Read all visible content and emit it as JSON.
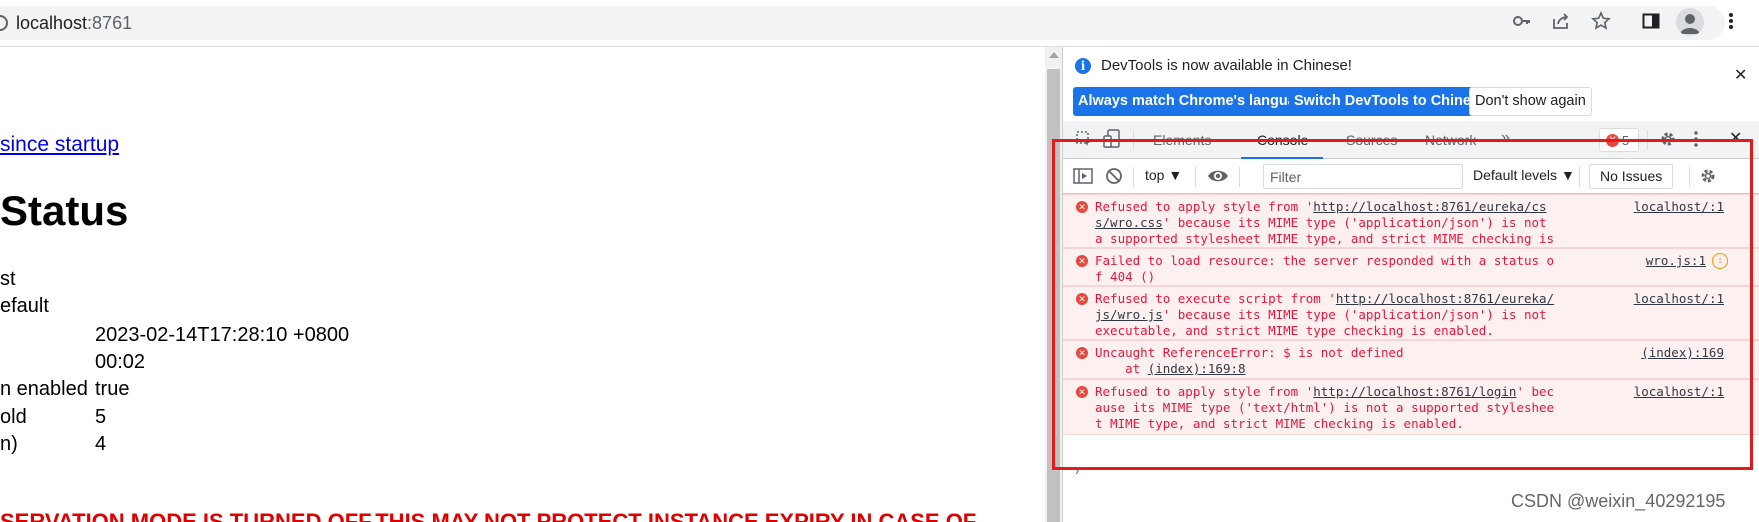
{
  "browser": {
    "url_host": "localhost",
    "url_port": ":8761",
    "icons": [
      "key-icon",
      "share-icon",
      "star-icon",
      "sidepanel-icon",
      "profile-icon",
      "menu-icon"
    ]
  },
  "page": {
    "link_text": "since startup",
    "heading": "Status",
    "rows": [
      {
        "label": "st",
        "value": ""
      },
      {
        "label": "efault",
        "value": ""
      },
      {
        "label": "",
        "value": "2023-02-14T17:28:10 +0800"
      },
      {
        "label": "",
        "value": "00:02"
      },
      {
        "label": "n enabled",
        "value": "true"
      },
      {
        "label": "old",
        "value": "5"
      },
      {
        "label": "n)",
        "value": "4"
      }
    ],
    "warning": "SERVATION MODE IS TURNED OFF.THIS MAY NOT PROTECT INSTANCE EXPIRY IN CASE OF"
  },
  "devtools": {
    "infobar": {
      "message": "DevTools is now available in Chinese!",
      "btn_match": "Always match Chrome's language",
      "btn_switch": "Switch DevTools to Chinese",
      "btn_dismiss": "Don't show again"
    },
    "tabs": [
      "Elements",
      "Console",
      "Sources",
      "Network"
    ],
    "more_tabs": "»",
    "error_count": "5",
    "console_toolbar": {
      "context": "top",
      "filter_placeholder": "Filter",
      "levels": "Default levels",
      "issues": "No Issues"
    },
    "messages": [
      {
        "pre": "Refused to apply style from '",
        "url": "http://localhost:8761/eureka/css/wro.css",
        "post": "' because its MIME type ('application/json') is not a supported stylesheet MIME type, and strict MIME checking is enabled.",
        "source": "localhost/:1"
      },
      {
        "pre": "Failed to load resource: the server responded with a status of 404 ()",
        "url": "",
        "post": "",
        "source": "wro.js:1"
      },
      {
        "pre": "Refused to execute script from '",
        "url": "http://localhost:8761/eureka/js/wro.js",
        "post": "' because its MIME type ('application/json') is not executable, and strict MIME type checking is enabled.",
        "source": "localhost/:1"
      },
      {
        "pre": "Uncaught ReferenceError: $ is not defined\n    at ",
        "url": "(index):169:8",
        "post": "",
        "source": "(index):169"
      },
      {
        "pre": "Refused to apply style from '",
        "url": "http://localhost:8761/login",
        "post": "' because its MIME type ('text/html') is not a supported stylesheet MIME type, and strict MIME checking is enabled.",
        "source": "localhost/:1"
      }
    ]
  },
  "watermark": "CSDN @weixin_40292195",
  "colors": {
    "error_text": "#e8173a",
    "error_bg": "#fdf0f0",
    "annotation": "#e51b1b",
    "accent": "#1a73e8"
  }
}
